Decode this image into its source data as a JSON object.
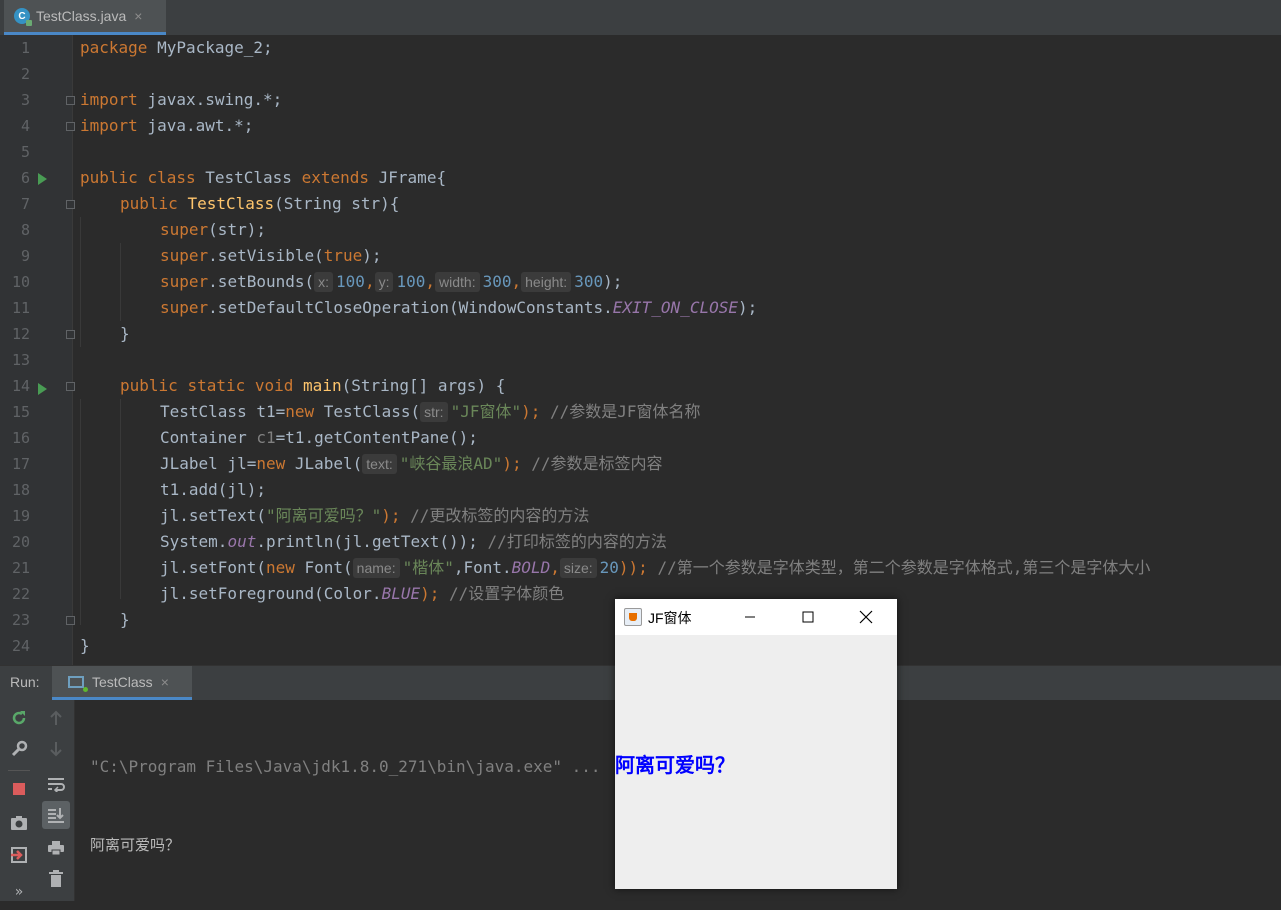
{
  "editor_tab": {
    "filename": "TestClass.java",
    "close": "×",
    "icon_letter": "C"
  },
  "line_numbers": [
    "1",
    "2",
    "3",
    "4",
    "5",
    "6",
    "7",
    "8",
    "9",
    "10",
    "11",
    "12",
    "13",
    "14",
    "15",
    "16",
    "17",
    "18",
    "19",
    "20",
    "21",
    "22",
    "23",
    "24"
  ],
  "code": {
    "l1": {
      "kw": "package",
      "rest": " MyPackage_2;"
    },
    "l3": {
      "kw": "import",
      "rest": " javax.swing.*;"
    },
    "l4": {
      "kw": "import",
      "rest": " java.awt.*;"
    },
    "l6": {
      "kw1": "public",
      "kw2": "class",
      "name": " TestClass ",
      "kw3": "extends",
      "rest": " JFrame{"
    },
    "l7": {
      "kw": "public",
      "fn": "TestClass",
      "rest": "(String str){"
    },
    "l8": {
      "kw": "super",
      "rest": "(str);"
    },
    "l9": {
      "kw": "super",
      "mid": ".setVisible(",
      "kw2": "true",
      "rest": ");"
    },
    "l10": {
      "kw": "super",
      "mid": ".setBounds(",
      "h1": "x:",
      "v1": "100",
      "h2": "y:",
      "v2": "100",
      "h3": "width:",
      "v3": "300",
      "h4": "height:",
      "v4": "300",
      "rest": ");"
    },
    "l11": {
      "kw": "super",
      "mid": ".setDefaultCloseOperation(WindowConstants.",
      "fld": "EXIT_ON_CLOSE",
      "rest": ");"
    },
    "l12": "}",
    "l14": {
      "kw1": "public",
      "kw2": "static",
      "kw3": "void",
      "fn": "main",
      "rest": "(String[] args) {"
    },
    "l15": {
      "pre": "TestClass t1=",
      "kw": "new",
      "mid": " TestClass(",
      "hint": "str:",
      "str": "\"JF窗体\"",
      "semi": ");",
      "cmt": "//参数是JF窗体名称"
    },
    "l16": {
      "pre": "Container ",
      "gray": "c1",
      "rest": "=t1.getContentPane();"
    },
    "l17": {
      "pre": "JLabel jl=",
      "kw": "new",
      "mid": " JLabel(",
      "hint": "text:",
      "str": "\"峡谷最浪AD\"",
      "semi": ");",
      "cmt": "//参数是标签内容"
    },
    "l18": "t1.add(jl);",
    "l19": {
      "pre": "jl.setText(",
      "str": "\"阿离可爱吗？\"",
      "semi": ");",
      "cmt": "//更改标签的内容的方法"
    },
    "l20": {
      "pre": "System.",
      "fld": "out",
      "mid": ".println(jl.getText());",
      "cmt": "//打印标签的内容的方法"
    },
    "l21": {
      "pre": "jl.setFont(",
      "kw": "new",
      "mid": " Font(",
      "h1": "name:",
      "str": "\"楷体\"",
      "mid2": ",Font.",
      "fld": "BOLD",
      "comma": ",",
      "h2": "size:",
      "num": "20",
      "semi": "));",
      "cmt": "//第一个参数是字体类型，第二个参数是字体格式,第三个是字体大小"
    },
    "l22": {
      "pre": "jl.setForeground(Color.",
      "fld": "BLUE",
      "semi": ");",
      "cmt": "//设置字体颜色"
    },
    "l23": "}",
    "l24": "}"
  },
  "run_panel": {
    "label": "Run:",
    "tab": "TestClass",
    "close": "×",
    "console_cmd": "\"C:\\Program Files\\Java\\jdk1.8.0_271\\bin\\java.exe\" ...",
    "console_out": "阿离可爱吗？"
  },
  "jframe": {
    "title": "JF窗体",
    "label_text": "阿离可爱吗？",
    "label_color": "#0000ff",
    "minimize": "—",
    "maximize": "☐",
    "close": "✕"
  },
  "toolbar_more": "»",
  "colors": {
    "keyword": "#cc7832",
    "string": "#6a8759",
    "number": "#6897bb",
    "comment": "#808080",
    "field": "#9876aa",
    "method_decl": "#ffc66d",
    "accent": "#4a88c7"
  }
}
